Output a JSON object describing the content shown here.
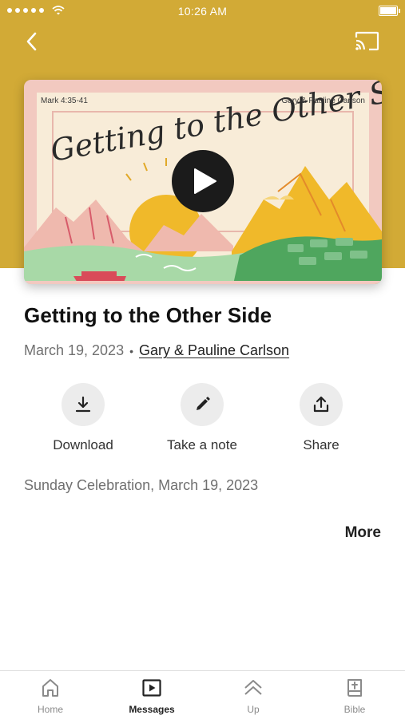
{
  "status_bar": {
    "time": "10:26 AM",
    "battery_level": 0.9
  },
  "header": {
    "back_icon": "chevron-left-icon",
    "cast_icon": "cast-icon",
    "band_color": "#d2aa36"
  },
  "hero": {
    "scripture_ref": "Mark 4:35-41",
    "speaker": "Gary & Pauline Carlson",
    "art_title": "Getting to the Other Side",
    "play_icon": "play-icon"
  },
  "message": {
    "title": "Getting to the Other Side",
    "date": "March 19, 2023",
    "separator": "•",
    "speaker": "Gary & Pauline Carlson"
  },
  "actions": [
    {
      "label": "Download",
      "icon": "download-icon"
    },
    {
      "label": "Take a note",
      "icon": "pencil-icon"
    },
    {
      "label": "Share",
      "icon": "share-icon"
    }
  ],
  "series_line": "Sunday Celebration, March 19, 2023",
  "more_label": "More",
  "tabs": [
    {
      "label": "Home",
      "icon": "home-icon",
      "active": false
    },
    {
      "label": "Messages",
      "icon": "play-square-icon",
      "active": true
    },
    {
      "label": "Up",
      "icon": "double-chevron-up-icon",
      "active": false
    },
    {
      "label": "Bible",
      "icon": "bible-icon",
      "active": false
    }
  ]
}
